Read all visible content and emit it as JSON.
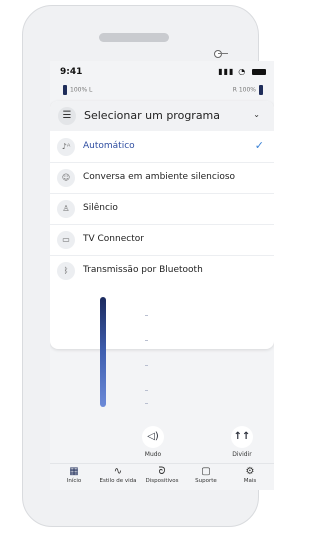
{
  "status": {
    "time": "9:41"
  },
  "hearing": {
    "left": "100% L",
    "right": "R 100%"
  },
  "program_panel": {
    "title": "Selecionar um programa",
    "items": [
      {
        "label": "Automático",
        "active": true
      },
      {
        "label": "Conversa em ambiente silencioso",
        "active": false
      },
      {
        "label": "Silêncio",
        "active": false
      },
      {
        "label": "TV Connector",
        "active": false
      },
      {
        "label": "Transmissão por Bluetooth",
        "active": false
      }
    ]
  },
  "controls": {
    "mute_label": "Mudo",
    "split_label": "Dividir"
  },
  "tabbar": [
    {
      "label": "Início",
      "icon": "home-grid-icon"
    },
    {
      "label": "Estilo de vida",
      "icon": "activity-icon"
    },
    {
      "label": "Dispositivos",
      "icon": "hearing-aid-icon"
    },
    {
      "label": "Suporte",
      "icon": "chat-icon"
    },
    {
      "label": "Mais",
      "icon": "gear-icon"
    }
  ],
  "colors": {
    "accent": "#2f4ea1",
    "check": "#3b82d6",
    "slider": "#1b2a5e"
  }
}
